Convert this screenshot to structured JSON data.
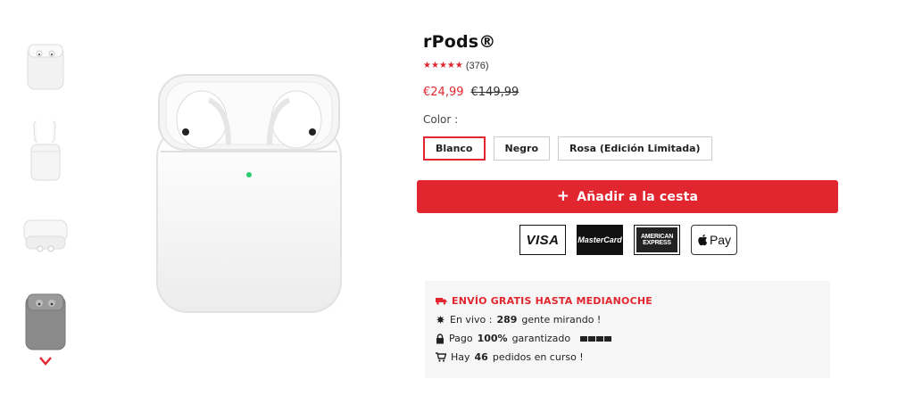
{
  "product": {
    "title": "rPods®",
    "review_count": "(376)",
    "stars": 5,
    "price_now": "€24,99",
    "price_old": "€149,99"
  },
  "color": {
    "label": "Color :",
    "options": [
      "Blanco",
      "Negro",
      "Rosa (Edición Limitada)"
    ],
    "selected": "Blanco"
  },
  "cart": {
    "button_label": "Añadir a la cesta"
  },
  "payments": {
    "visa": "VISA",
    "mastercard": "MasterCard",
    "amex_line1": "AMERICAN",
    "amex_line2": "EXPRESS",
    "applepay": "Pay"
  },
  "info_box": {
    "shipping": "ENVÍO GRATIS HASTA MEDIANOCHE",
    "live_prefix": "En vivo : ",
    "live_count": "289",
    "live_suffix": " gente mirando !",
    "payment_prefix": "Pago ",
    "payment_bold": "100%",
    "payment_suffix": " garantizado",
    "orders_prefix": "Hay ",
    "orders_count": "46",
    "orders_suffix": " pedidos en curso !"
  },
  "colors": {
    "accent": "#e2262f",
    "box_bg": "#f6f6f6"
  },
  "icons": [
    "chevron-down-icon",
    "plus-icon",
    "truck-icon",
    "eye-icon",
    "lock-icon",
    "cart-icon",
    "apple-icon",
    "star-icon"
  ]
}
